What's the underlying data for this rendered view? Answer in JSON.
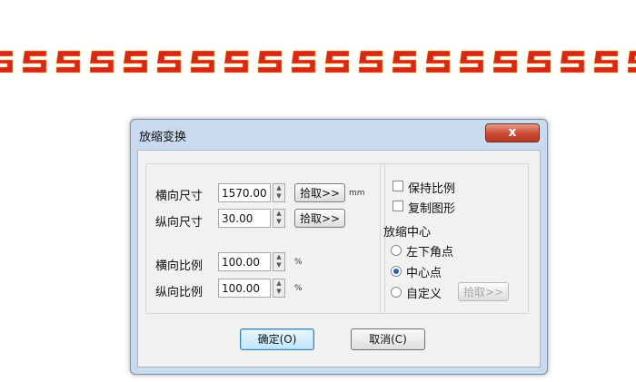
{
  "decoration": {
    "pattern": "red-key-fret-border",
    "color": "#d8261a",
    "accent": "#f1b41c"
  },
  "dialog": {
    "title": "放缩变换",
    "close_label": "x",
    "size": {
      "width_label": "横向尺寸",
      "width_value": "1570.00",
      "height_label": "纵向尺寸",
      "height_value": "30.00",
      "pick_label": "拾取>>",
      "unit_mm": "mm"
    },
    "scale": {
      "h_label": "横向比例",
      "h_value": "100.00",
      "v_label": "纵向比例",
      "v_value": "100.00",
      "unit_pct": "%"
    },
    "options": {
      "keep_ratio": "保持比例",
      "copy_shape": "复制图形"
    },
    "center": {
      "group_label": "放缩中心",
      "opt_bottom_left": "左下角点",
      "opt_center": "中心点",
      "opt_custom": "自定义",
      "selected": "中心点",
      "pick_label": "拾取>>"
    },
    "ok_label": "确定(O)",
    "cancel_label": "取消(C)"
  }
}
